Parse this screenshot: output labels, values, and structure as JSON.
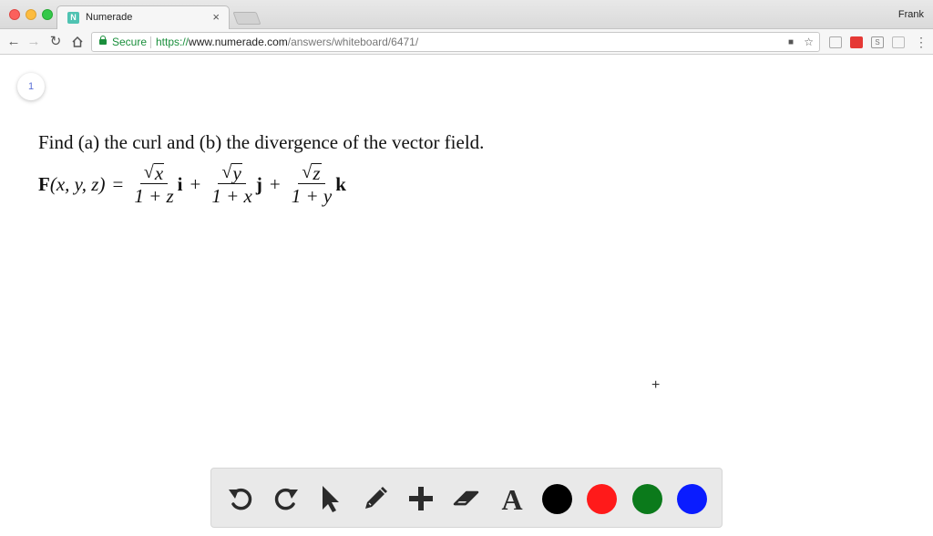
{
  "browser": {
    "tab_title": "Numerade",
    "tab_favicon_letter": "N",
    "tab_close": "×",
    "profile_name": "Frank",
    "secure_label": "Secure",
    "url_scheme": "https://",
    "url_host": "www.numerade.com",
    "url_path": "/answers/whiteboard/6471/"
  },
  "whiteboard": {
    "page_number": "1",
    "question": "Find (a) the curl and (b) the divergence of the vector field.",
    "equation": {
      "lhs_F": "F",
      "lhs_args": "(x, y, z)",
      "equals": "=",
      "terms": [
        {
          "radicand": "x",
          "denominator": "1 + z",
          "unit": "i"
        },
        {
          "radicand": "y",
          "denominator": "1 + x",
          "unit": "j"
        },
        {
          "radicand": "z",
          "denominator": "1 + y",
          "unit": "k"
        }
      ],
      "plus": "+",
      "sqrt_symbol": "√"
    },
    "cursor_symbol": "+"
  },
  "drawing_toolbar": {
    "tools": [
      "undo-icon",
      "redo-icon",
      "pointer-icon",
      "pencil-icon",
      "plus-icon",
      "eraser-icon",
      "text-icon"
    ],
    "text_tool_glyph": "A",
    "colors": [
      "#000000",
      "#ff1a1a",
      "#0b7a1b",
      "#0a1cff"
    ]
  }
}
